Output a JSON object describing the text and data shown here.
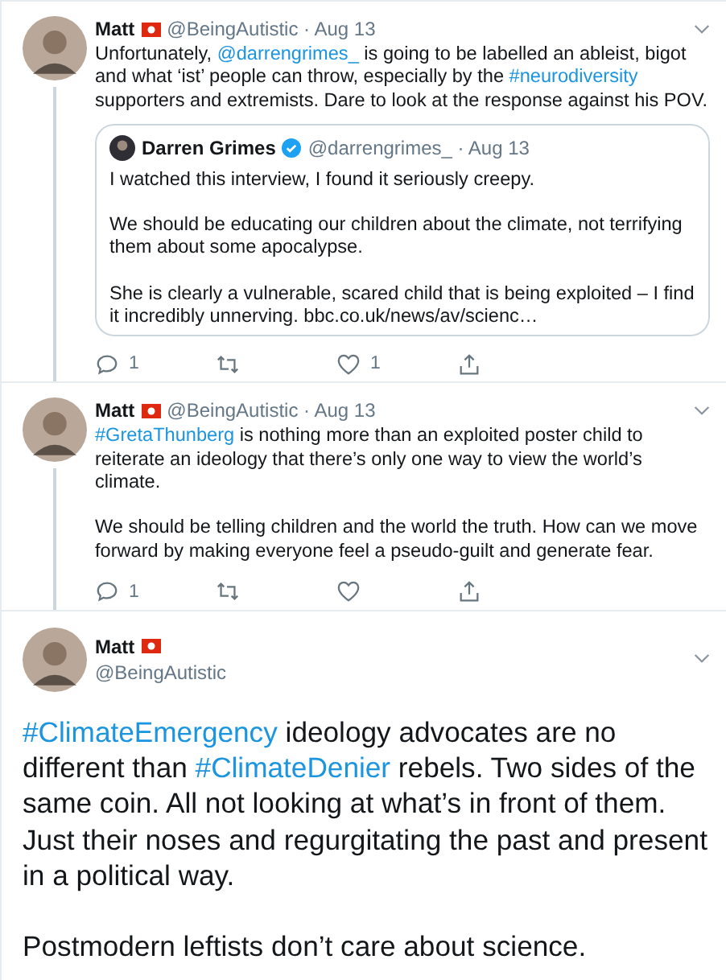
{
  "thread": [
    {
      "name": "Matt",
      "byline": "@BeingAutistic · Aug 13",
      "paragraphs": [
        [
          {
            "kind": "plain",
            "text": "Unfortunately, "
          },
          {
            "kind": "link",
            "text": "@darrengrimes_"
          },
          {
            "kind": "plain",
            "text": " is going to be labelled an ableist, bigot and what ‘ist’ people can throw, especially by the "
          },
          {
            "kind": "link",
            "text": "#neurodiversity"
          },
          {
            "kind": "plain",
            "text": " supporters and extremists. Dare to look at the response against his POV."
          }
        ]
      ],
      "quote": {
        "name": "Darren Grimes",
        "verified": true,
        "byline": "@darrengrimes_ · Aug 13",
        "paragraphs": [
          "I watched this interview, I found it seriously creepy.",
          "We should be educating our children about the climate, not terrifying them about some apocalypse.",
          "She is clearly a vulnerable, scared child that is being exploited – I find it incredibly unnerving. bbc.co.uk/news/av/scienc…"
        ]
      },
      "actions": {
        "replies": "1",
        "likes": "1"
      }
    },
    {
      "name": "Matt",
      "byline": "@BeingAutistic · Aug 13",
      "paragraphs": [
        [
          {
            "kind": "link",
            "text": "#GretaThunberg"
          },
          {
            "kind": "plain",
            "text": " is nothing more than an exploited poster child to reiterate an ideology that there’s only one way to view the world’s climate."
          }
        ],
        [
          {
            "kind": "plain",
            "text": "We should be telling children and the world the truth. How can we move forward by making everyone feel a pseudo-guilt and generate fear."
          }
        ]
      ],
      "actions": {
        "replies": "1"
      }
    }
  ],
  "main": {
    "name": "Matt",
    "handle": "@BeingAutistic",
    "paragraphs": [
      [
        {
          "kind": "link",
          "text": "#ClimateEmergency"
        },
        {
          "kind": "plain",
          "text": " ideology advocates are no different than "
        },
        {
          "kind": "link",
          "text": "#ClimateDenier"
        },
        {
          "kind": "plain",
          "text": " rebels. Two sides of the same coin. All not looking at what’s in front of them. Just their noses and regurgitating the past and present in a political way."
        }
      ],
      [
        {
          "kind": "plain",
          "text": "Postmodern leftists don’t care about science."
        }
      ]
    ]
  }
}
